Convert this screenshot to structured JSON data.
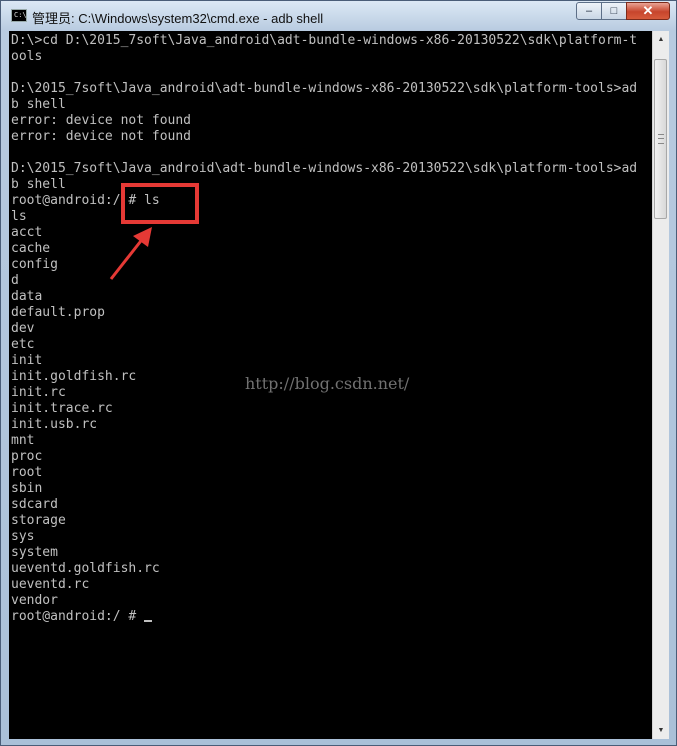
{
  "window": {
    "title": "管理员: C:\\Windows\\system32\\cmd.exe - adb  shell",
    "icon_label": "C:\\",
    "buttons": {
      "minimize": "‒",
      "maximize": "□",
      "close": "✕"
    }
  },
  "console": {
    "lines": [
      "D:\\>cd D:\\2015_7soft\\Java_android\\adt-bundle-windows-x86-20130522\\sdk\\platform-t",
      "ools",
      "",
      "D:\\2015_7soft\\Java_android\\adt-bundle-windows-x86-20130522\\sdk\\platform-tools>ad",
      "b shell",
      "error: device not found",
      "error: device not found",
      "",
      "D:\\2015_7soft\\Java_android\\adt-bundle-windows-x86-20130522\\sdk\\platform-tools>ad",
      "b shell",
      "root@android:/ # ls",
      "ls",
      "acct",
      "cache",
      "config",
      "d",
      "data",
      "default.prop",
      "dev",
      "etc",
      "init",
      "init.goldfish.rc",
      "init.rc",
      "init.trace.rc",
      "init.usb.rc",
      "mnt",
      "proc",
      "root",
      "sbin",
      "sdcard",
      "storage",
      "sys",
      "system",
      "ueventd.goldfish.rc",
      "ueventd.rc",
      "vendor"
    ],
    "prompt": "root@android:/ # "
  },
  "watermark": "http://blog.csdn.net/",
  "colors": {
    "console_bg": "#000000",
    "console_text": "#c0c0c0",
    "annotation": "#e53935"
  }
}
